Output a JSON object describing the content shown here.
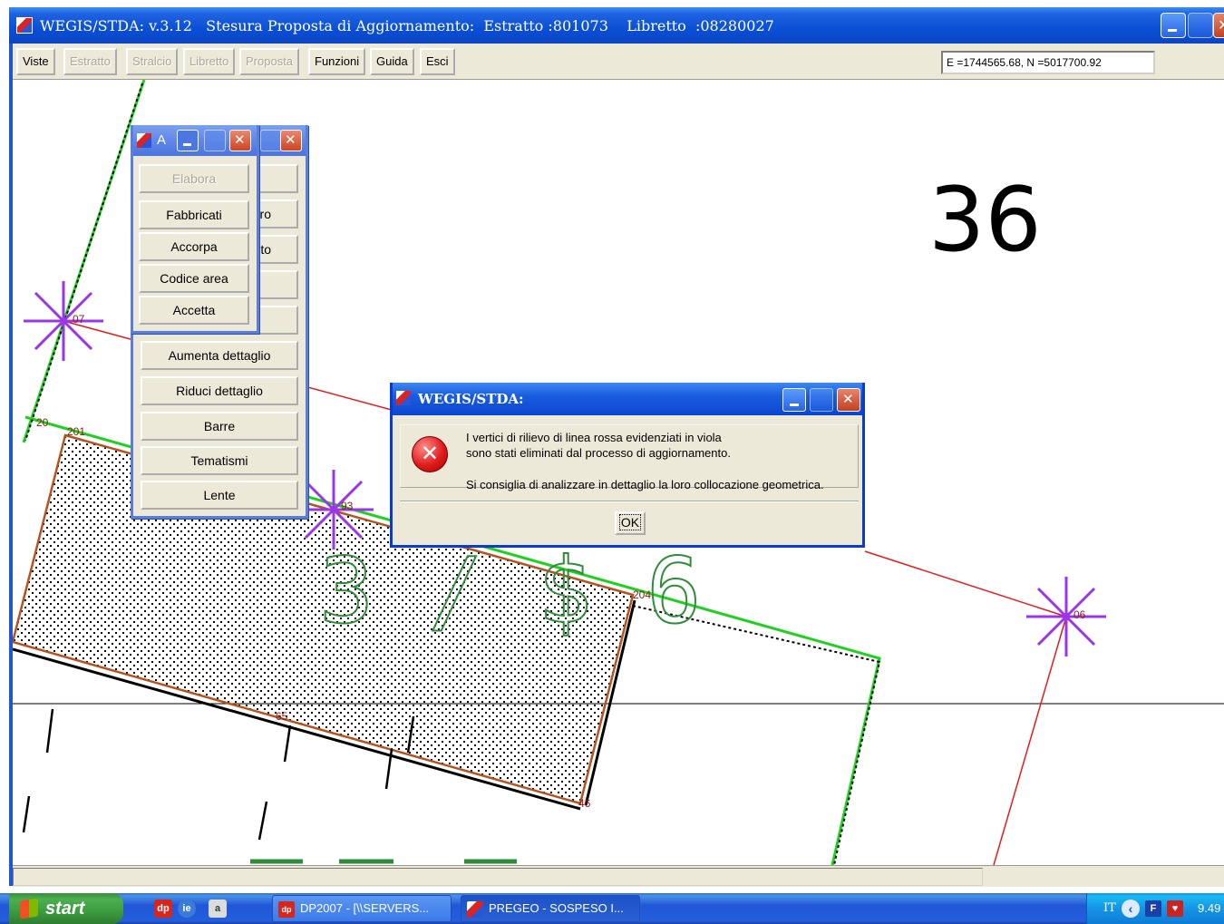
{
  "window": {
    "title": "WEGIS/STDA: v.3.12   Stesura Proposta di Aggiornamento:  Estratto :801073    Libretto  :08280027"
  },
  "menubar": {
    "items": [
      {
        "label": "Viste",
        "enabled": true
      },
      {
        "label": "Estratto",
        "enabled": false
      },
      {
        "label": "Stralcio",
        "enabled": false
      },
      {
        "label": "Libretto",
        "enabled": false
      },
      {
        "label": "Proposta",
        "enabled": false
      },
      {
        "label": "Funzioni",
        "enabled": true
      },
      {
        "label": "Guida",
        "enabled": true
      },
      {
        "label": "Esci",
        "enabled": true
      }
    ],
    "coordinates": "E =1744565.68,  N =5017700.92"
  },
  "map": {
    "sheet_number": "36",
    "parcel_label": "3 / $ 6",
    "point_labels": [
      "07",
      "20",
      "201",
      "93",
      "204",
      "06",
      "46",
      "65"
    ],
    "colors": {
      "boundary_green": "#1fd11f",
      "line_red": "#e31d1d",
      "building_brown": "#b5521e",
      "marker_purple": "#9b36e6",
      "parcel_text_green": "#2f8c3a"
    }
  },
  "tool_window_back": {
    "buttons": [
      "ro",
      "to",
      "Aumenta dettaglio",
      "Riduci dettaglio",
      "Barre",
      "Tematismi",
      "Lente"
    ]
  },
  "tool_window_front": {
    "title": "A",
    "buttons": [
      {
        "label": "Elabora",
        "enabled": false
      },
      {
        "label": "Fabbricati",
        "enabled": true
      },
      {
        "label": "Accorpa",
        "enabled": true
      },
      {
        "label": "Codice area",
        "enabled": true
      },
      {
        "label": "Accetta",
        "enabled": true
      }
    ]
  },
  "dialog": {
    "title": "WEGIS/STDA:",
    "message_line1": "I vertici di rilievo di linea rossa evidenziati in viola",
    "message_line2": "sono stati eliminati dal processo di aggiornamento.",
    "message_line3": "Si consiglia di analizzare in dettaglio la loro collocazione geometrica.",
    "ok_label": "OK",
    "icon": "error-icon"
  },
  "taskbar": {
    "start_label": "start",
    "quick_launch": [
      "dp",
      "ie",
      "a"
    ],
    "tasks": [
      {
        "label": "DP2007 - [\\\\SERVERS...",
        "icon": "dp"
      },
      {
        "label": "PREGEO - SOSPESO I...",
        "icon": "pregeo"
      }
    ],
    "tray": {
      "language": "IT",
      "clock": "9.49"
    }
  }
}
